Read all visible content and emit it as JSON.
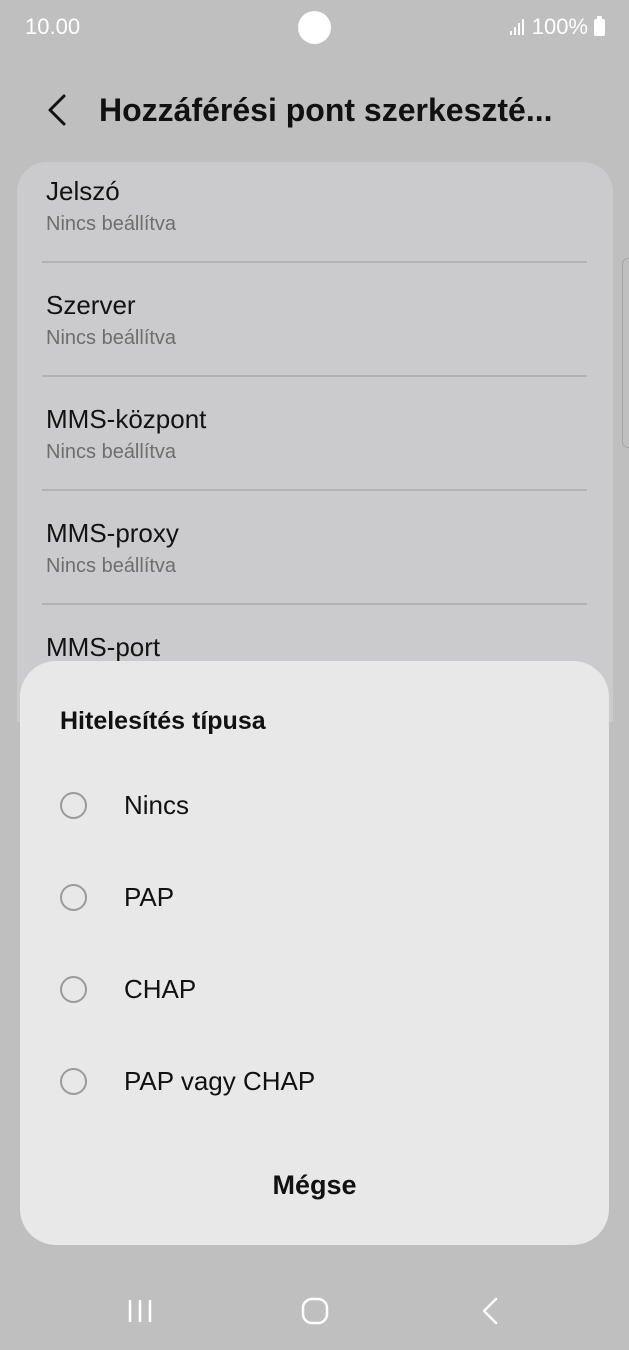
{
  "status_bar": {
    "time": "10.00",
    "battery": "100%"
  },
  "header": {
    "title": "Hozzáférési pont szerkeszté..."
  },
  "settings": {
    "items": [
      {
        "title": "Jelszó",
        "subtitle": "Nincs beállítva"
      },
      {
        "title": "Szerver",
        "subtitle": "Nincs beállítva"
      },
      {
        "title": "MMS-központ",
        "subtitle": "Nincs beállítva"
      },
      {
        "title": "MMS-proxy",
        "subtitle": "Nincs beállítva"
      },
      {
        "title": "MMS-port",
        "subtitle": ""
      }
    ]
  },
  "dialog": {
    "title": "Hitelesítés típusa",
    "options": [
      {
        "label": "Nincs",
        "selected": false
      },
      {
        "label": "PAP",
        "selected": false
      },
      {
        "label": "CHAP",
        "selected": false
      },
      {
        "label": "PAP vagy CHAP",
        "selected": false
      }
    ],
    "cancel_label": "Mégse"
  },
  "nav_bar": {
    "icons": [
      "recents-icon",
      "home-icon",
      "back-icon"
    ]
  }
}
